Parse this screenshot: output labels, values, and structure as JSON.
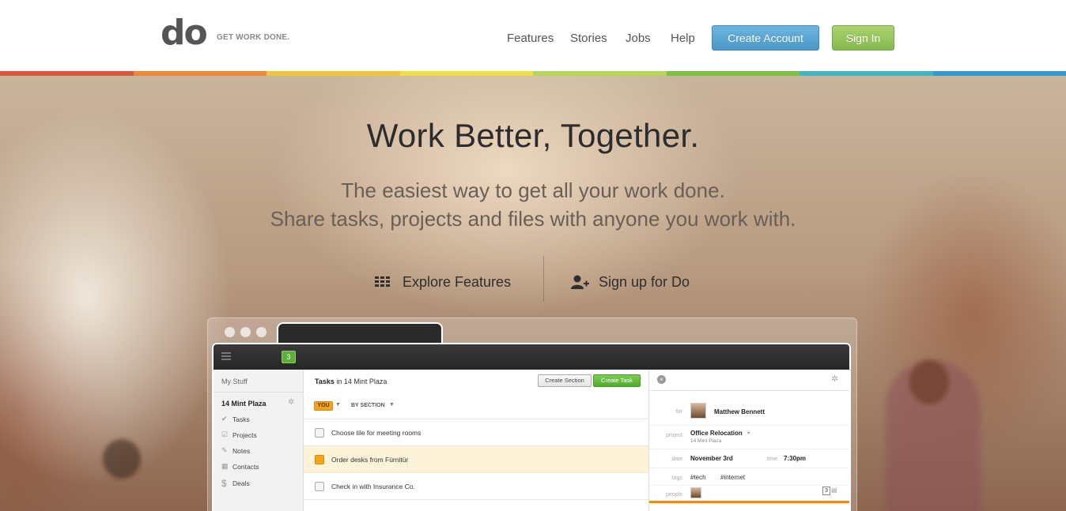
{
  "header": {
    "logo": "do",
    "tagline": "GET WORK DONE.",
    "nav": [
      "Features",
      "Stories",
      "Jobs",
      "Help"
    ],
    "create_account": "Create Account",
    "sign_in": "Sign In"
  },
  "rainbow_colors": [
    "#e2533a",
    "#f1892e",
    "#f2c633",
    "#f0e13a",
    "#b6d657",
    "#7cc242",
    "#3db8c4",
    "#2d9ad7"
  ],
  "hero": {
    "title": "Work Better, Together.",
    "subtitle_1": "The easiest way to get all your work done.",
    "subtitle_2": "Share tasks, projects and files with anyone you work with.",
    "explore": "Explore Features",
    "signup": "Sign up for Do"
  },
  "app": {
    "badge_count": "3",
    "sidebar": {
      "title": "My Stuff",
      "project": "14 Mint Plaza",
      "items": [
        {
          "icon": "✔",
          "label": "Tasks"
        },
        {
          "icon": "☑",
          "label": "Projects"
        },
        {
          "icon": "✎",
          "label": "Notes"
        },
        {
          "icon": "▦",
          "label": "Contacts"
        },
        {
          "icon": "$",
          "label": "Deals"
        }
      ]
    },
    "main": {
      "title_bold": "Tasks",
      "title_rest": " in 14 Mint Plaza",
      "create_section": "Create Section",
      "create_task": "Create Task",
      "filter_you": "YOU",
      "filter_section": "BY SECTION",
      "tasks": [
        {
          "label": "Choose tile for meeting rooms",
          "selected": false
        },
        {
          "label": "Order desks from Fürnitür",
          "selected": true
        },
        {
          "label": "Check in with Insurance Co.",
          "selected": false
        }
      ]
    },
    "detail": {
      "for_label": "for",
      "for_value": "Matthew Bennett",
      "project_label": "project",
      "project_value": "Office Relocation",
      "project_sub": "14 Mint Plaza",
      "date_label": "date",
      "date_value": "November 3rd",
      "time_label": "time",
      "time_value": "7:30pm",
      "tags_label": "tags",
      "tag_1": "#tech",
      "tag_2": "#internet",
      "people_label": "people",
      "people_count": "3"
    }
  }
}
